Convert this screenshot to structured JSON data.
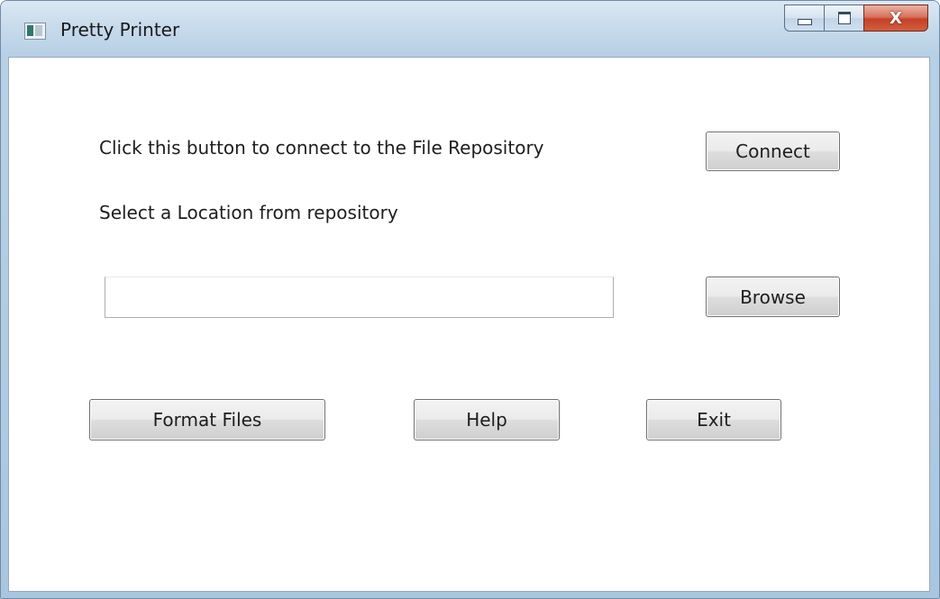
{
  "window": {
    "title": "Pretty Printer",
    "controls": {
      "minimize_icon": "minimize-icon",
      "maximize_icon": "maximize-icon",
      "close_glyph": "X"
    }
  },
  "main": {
    "connect_prompt": "Click this button to connect to the File Repository",
    "connect_button": "Connect",
    "location_prompt": "Select a Location from repository",
    "location_input": {
      "value": "",
      "placeholder": ""
    },
    "browse_button": "Browse",
    "format_button": "Format Files",
    "help_button": "Help",
    "exit_button": "Exit"
  },
  "colors": {
    "title_bar": "#c8dbec",
    "close_button": "#c4412a",
    "button_face": "#e5e5e5",
    "button_border": "#707070"
  }
}
